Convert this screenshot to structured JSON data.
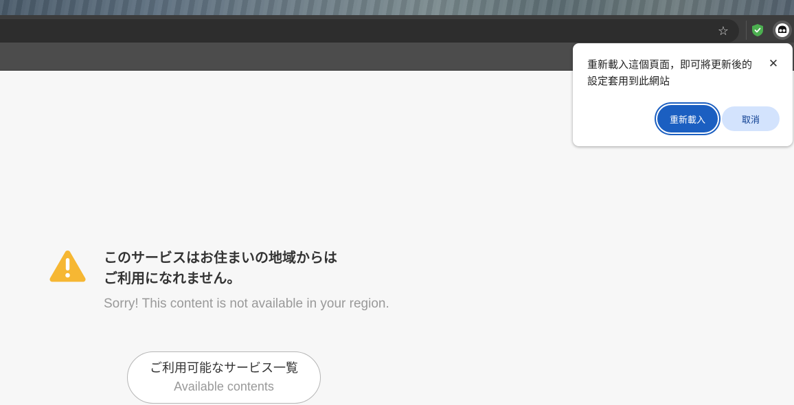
{
  "browser": {
    "toolbar_icons": {
      "bookmark": "star-icon",
      "extension_shield": "shield-icon",
      "extension_active": "ghost-icon"
    }
  },
  "popup": {
    "message": "重新載入這個頁面，即可將更新後的設定套用到此網站",
    "close_label": "✕",
    "reload_label": "重新載入",
    "cancel_label": "取消"
  },
  "page": {
    "headline_line1": "このサービスはお住まいの地域からは",
    "headline_line2": "ご利用になれません。",
    "subtext": "Sorry! This content is not available in your region.",
    "button_jp": "ご利用可能なサービス一覧",
    "button_en": "Available contents"
  },
  "colors": {
    "warning": "#f6b733",
    "primary": "#1b5fc1",
    "secondary": "#d3e3fd",
    "shield": "#4caf50"
  }
}
